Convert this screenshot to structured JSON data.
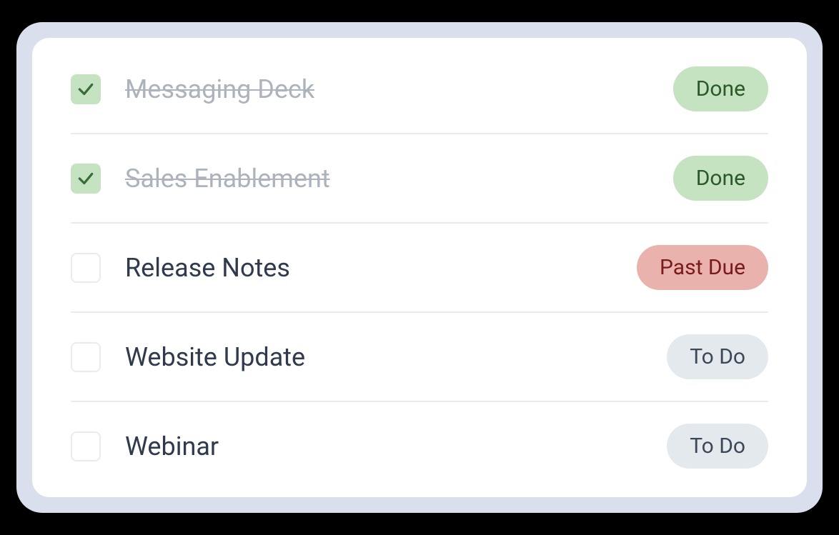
{
  "tasks": [
    {
      "title": "Messaging Deck",
      "checked": true,
      "status_label": "Done",
      "status_kind": "done"
    },
    {
      "title": "Sales Enablement",
      "checked": true,
      "status_label": "Done",
      "status_kind": "done"
    },
    {
      "title": "Release Notes",
      "checked": false,
      "status_label": "Past Due",
      "status_kind": "pastdue"
    },
    {
      "title": "Website Update",
      "checked": false,
      "status_label": "To Do",
      "status_kind": "todo"
    },
    {
      "title": "Webinar",
      "checked": false,
      "status_label": "To Do",
      "status_kind": "todo"
    }
  ]
}
